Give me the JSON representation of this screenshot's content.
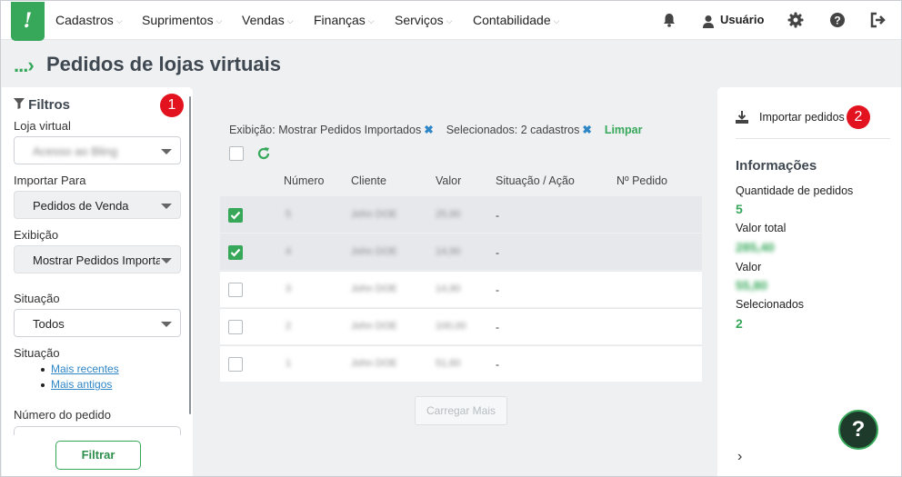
{
  "nav": {
    "logo": "!",
    "items": [
      "Cadastros",
      "Suprimentos",
      "Vendas",
      "Finanças",
      "Serviços",
      "Contabilidade"
    ],
    "user": "Usuário",
    "icons": [
      "bell-icon",
      "user-icon",
      "gear-icon",
      "help-icon",
      "logout-icon"
    ]
  },
  "page": {
    "crumb": "...",
    "title": "Pedidos de lojas virtuais"
  },
  "filters": {
    "title": "Filtros",
    "store_label": "Loja virtual",
    "store_value": "Acesso ao Bling",
    "import_label": "Importar Para",
    "import_value": "Pedidos de Venda",
    "display_label": "Exibição",
    "display_value": "Mostrar Pedidos Importados",
    "status_label": "Situação",
    "status_value": "Todos",
    "sort_label": "Situação",
    "sort_links": [
      "Mais recentes",
      "Mais antigos"
    ],
    "order_number_label": "Número do pedido",
    "submit": "Filtrar"
  },
  "chips": {
    "display": "Exibição: Mostrar Pedidos Importados",
    "selected": "Selecionados: 2 cadastros",
    "clear": "Limpar"
  },
  "table": {
    "headers": [
      "Número",
      "Cliente",
      "Valor",
      "Situação / Ação",
      "Nº Pedido"
    ],
    "rows": [
      {
        "checked": true,
        "numero": "5",
        "cliente": "John DOE",
        "valor": "25,90",
        "situacao": "-"
      },
      {
        "checked": true,
        "numero": "4",
        "cliente": "John DOE",
        "valor": "14,90",
        "situacao": "-"
      },
      {
        "checked": false,
        "numero": "3",
        "cliente": "John DOE",
        "valor": "14,90",
        "situacao": "-"
      },
      {
        "checked": false,
        "numero": "2",
        "cliente": "John DOE",
        "valor": "100,00",
        "situacao": "-"
      },
      {
        "checked": false,
        "numero": "1",
        "cliente": "John DOE",
        "valor": "51,60",
        "situacao": "-"
      }
    ],
    "load_more": "Carregar Mais"
  },
  "info": {
    "import_button": "Importar pedidos",
    "title": "Informações",
    "qty_label": "Quantidade de pedidos",
    "qty_value": "5",
    "total_label": "Valor total",
    "total_value": "285,40",
    "value_label": "Valor",
    "value_value": "55,80",
    "selected_label": "Selecionados",
    "selected_value": "2",
    "help": "?",
    "expand": "›"
  },
  "badges": [
    "1",
    "2"
  ],
  "colors": {
    "brand": "#37a85a",
    "link": "#2f86c7",
    "badge": "#e2131f",
    "help_bg": "#1d3a2b"
  }
}
